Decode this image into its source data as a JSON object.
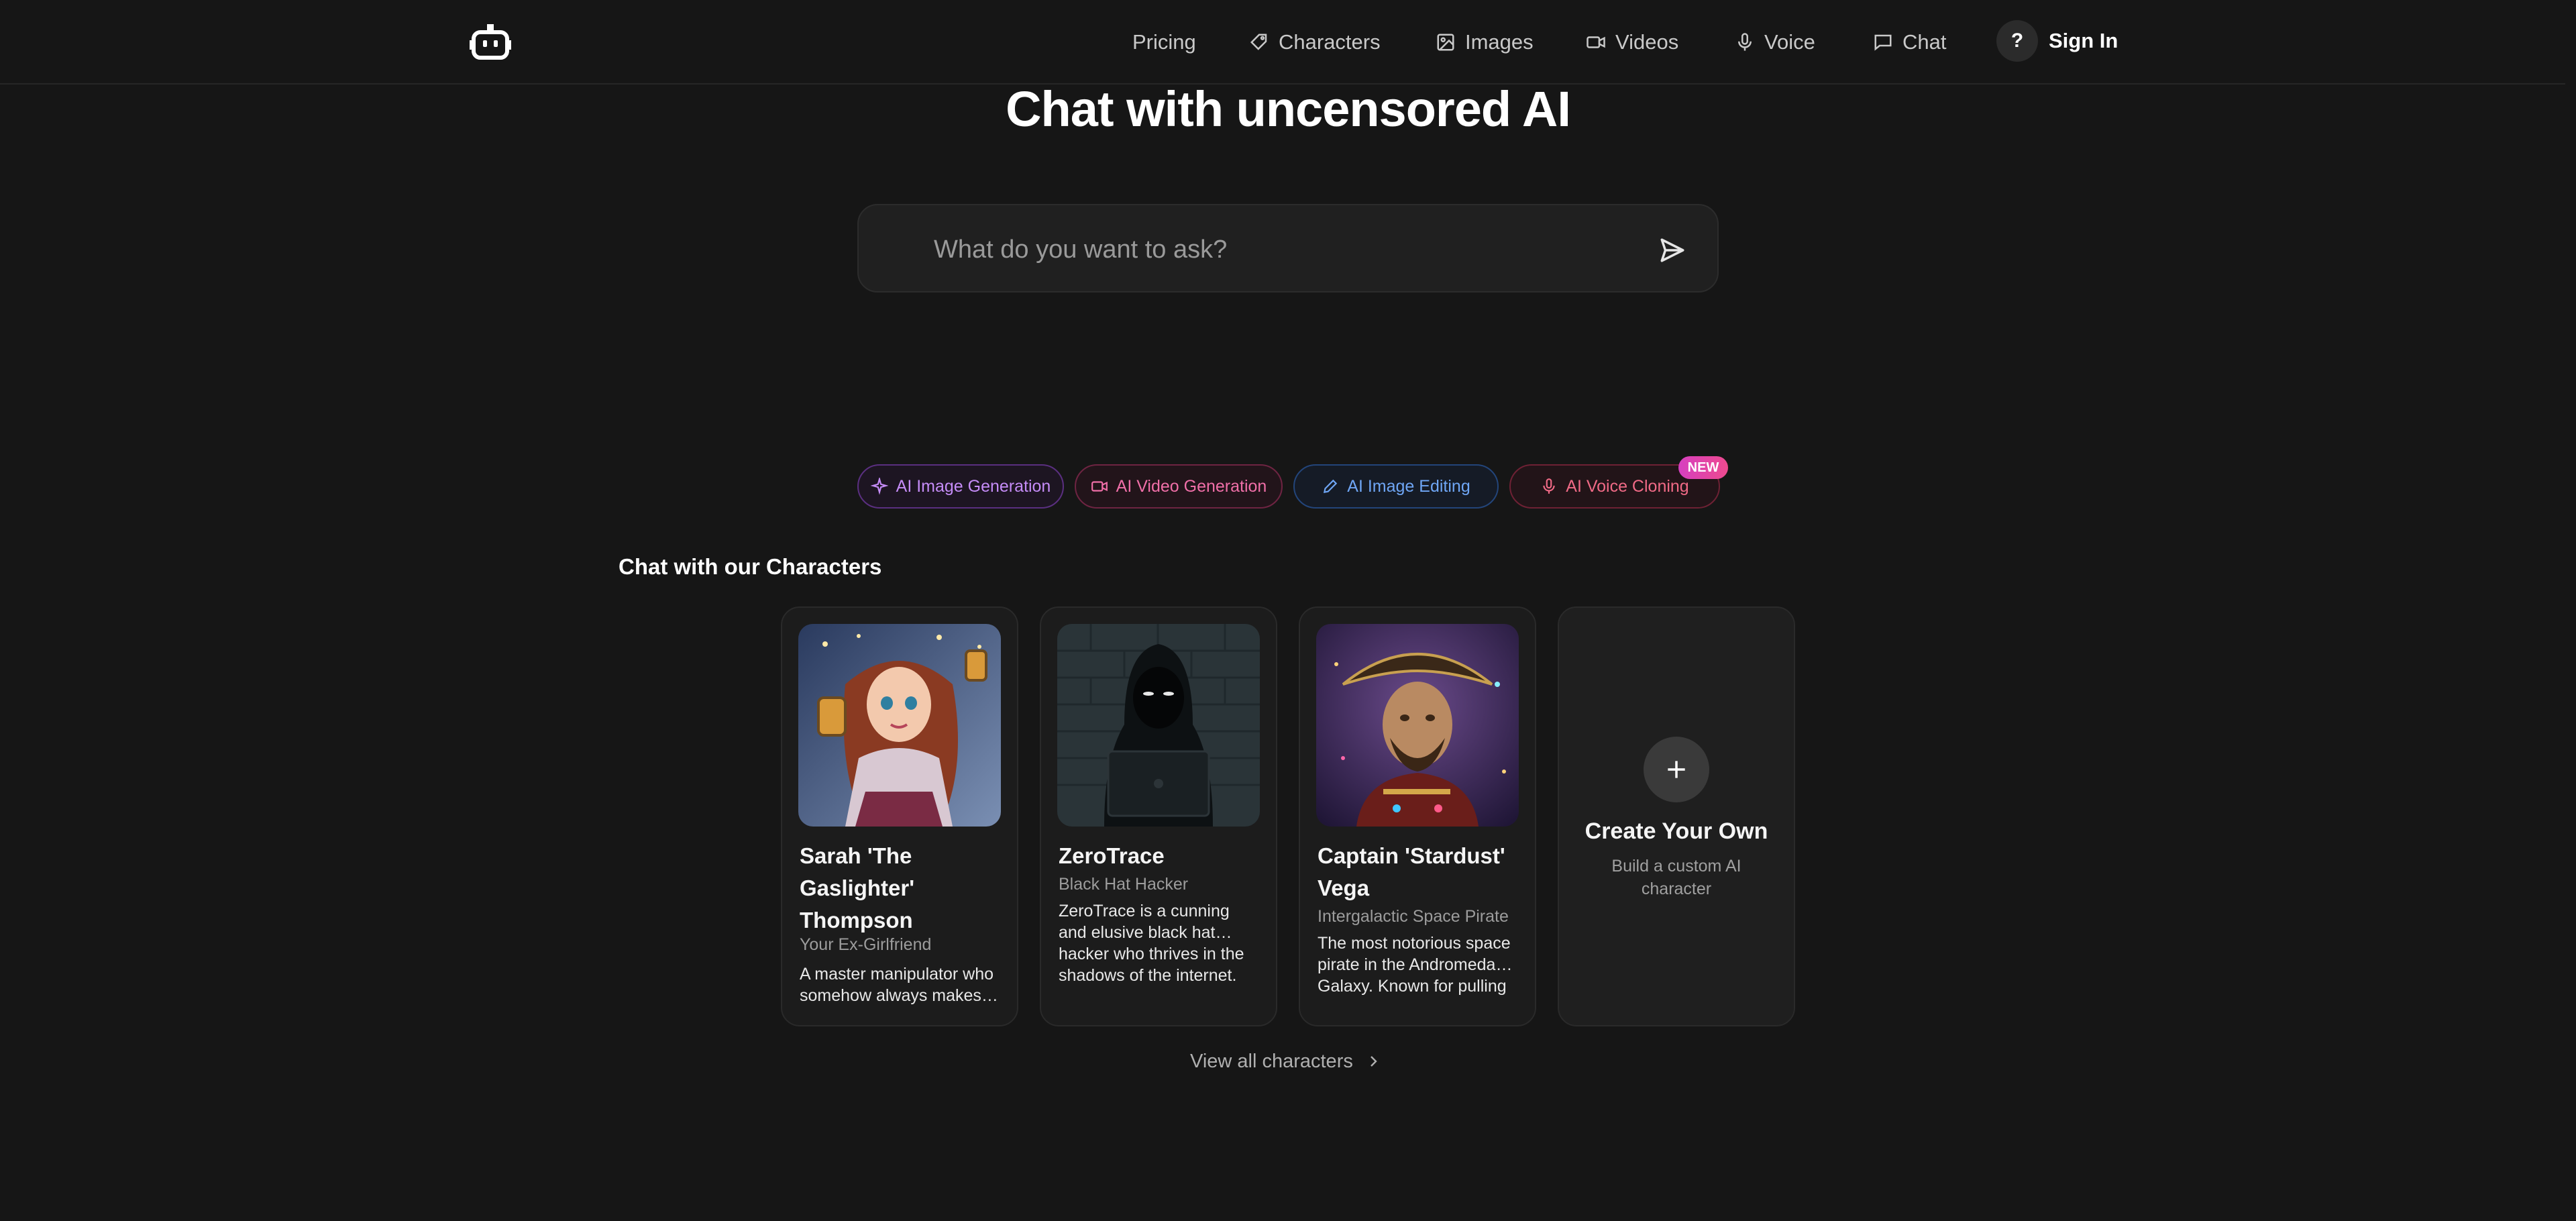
{
  "nav": {
    "items": [
      {
        "label": "Pricing",
        "icon": "none"
      },
      {
        "label": "Characters",
        "icon": "tag-icon"
      },
      {
        "label": "Images",
        "icon": "image-icon"
      },
      {
        "label": "Videos",
        "icon": "video-icon"
      },
      {
        "label": "Voice",
        "icon": "mic-icon"
      },
      {
        "label": "Chat",
        "icon": "chat-bubble-icon"
      }
    ],
    "help_label": "?",
    "sign_in_label": "Sign In"
  },
  "hero": {
    "title": "Chat with uncensored AI",
    "ask_placeholder": "What do you want to ask?"
  },
  "features": [
    {
      "label": "AI Image Generation",
      "color": "#c58cf7",
      "border": "#5a2f80",
      "bg": "#1d1522"
    },
    {
      "label": "AI Video Generation",
      "color": "#f06fa8",
      "border": "#6e2442",
      "bg": "#22141a"
    },
    {
      "label": "AI Image Editing",
      "color": "#6fa6f5",
      "border": "#23457a",
      "bg": "#151b26"
    },
    {
      "label": "AI Voice Cloning",
      "color": "#f06a86",
      "border": "#6e2134",
      "bg": "#221418"
    }
  ],
  "new_badge": "NEW",
  "characters_section": {
    "title": "Chat with our Characters",
    "cards": [
      {
        "name": "Sarah 'The Gaslighter' Thompson",
        "role": "Your Ex-Girlfriend",
        "desc": "A master manipulator who somehow always makes…"
      },
      {
        "name": "ZeroTrace",
        "role": "Black Hat Hacker",
        "desc": "ZeroTrace is a cunning and elusive black hat… hacker who thrives in the shadows of the internet. With unmatched skill in"
      },
      {
        "name": "Captain 'Stardust' Vega",
        "role": "Intergalactic Space Pirate",
        "desc": "The most notorious space pirate in the Andromeda… Galaxy. Known for pulling off impossible heists"
      }
    ],
    "create": {
      "title": "Create Your Own",
      "subtitle": "Build a custom AI character"
    },
    "view_all": "View all characters"
  }
}
